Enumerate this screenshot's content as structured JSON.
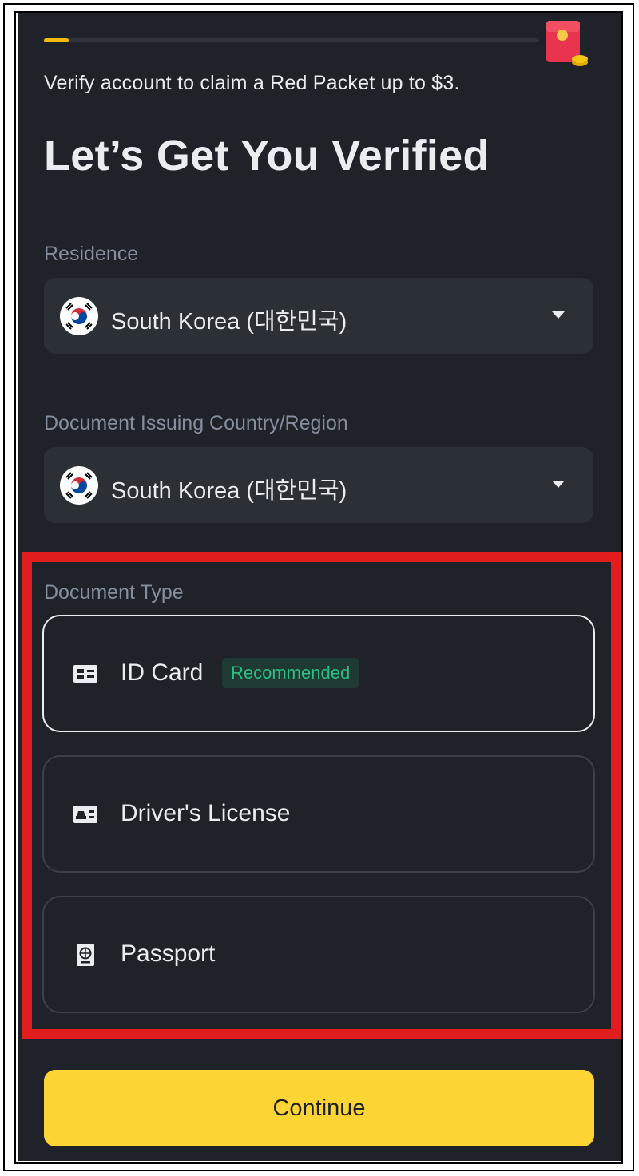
{
  "progress": {
    "fraction": 0.05,
    "fill_color": "#f0b90b"
  },
  "promo_icon": "red-packet-icon",
  "promo_text": "Verify account to claim a Red Packet up to $3.",
  "title": "Let’s Get You Verified",
  "residence": {
    "label": "Residence",
    "value": "South Korea (대한민국)",
    "flag_icon": "south-korea-flag-icon"
  },
  "issuing_country": {
    "label": "Document Issuing Country/Region",
    "value": "South Korea (대한민국)",
    "flag_icon": "south-korea-flag-icon"
  },
  "document_type": {
    "label": "Document Type",
    "options": [
      {
        "label": "ID Card",
        "badge": "Recommended",
        "icon": "id-card-icon",
        "selected": true
      },
      {
        "label": "Driver's License",
        "icon": "drivers-license-icon",
        "selected": false
      },
      {
        "label": "Passport",
        "icon": "passport-icon",
        "selected": false
      }
    ]
  },
  "continue_label": "Continue",
  "colors": {
    "background": "#1f2229",
    "field": "#2b2f36",
    "accent": "#fcd535",
    "badge_text": "#2ebd85",
    "highlight": "#e11d1d"
  }
}
